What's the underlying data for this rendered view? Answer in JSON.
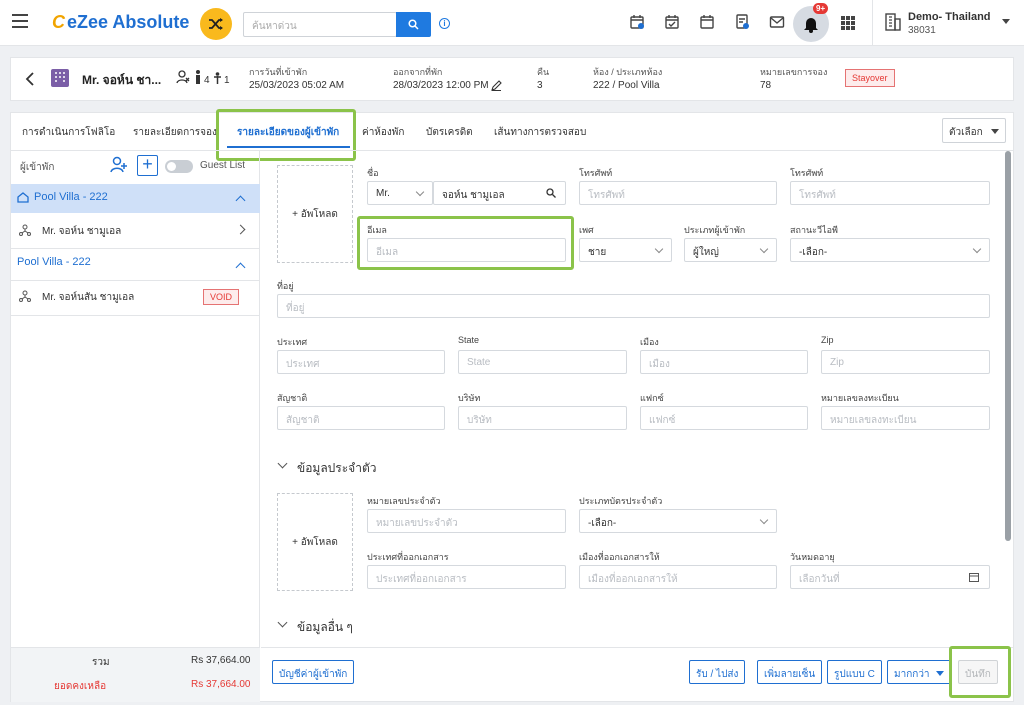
{
  "topbar": {
    "logo_prefix": "C",
    "logo_text": "eZee Absolute",
    "search_placeholder": "ค้นหาด่วน",
    "notif_badge": "9+",
    "property_name": "Demo- Thailand",
    "property_id": "38031"
  },
  "reservation": {
    "guest_name": "Mr. จอห์น ชา...",
    "adults": "4",
    "children": "1",
    "checkin_label": "การวันที่เข้าพัก",
    "checkin_value": "25/03/2023 05:02 AM",
    "checkout_label": "ออกจากที่พัก",
    "checkout_value": "28/03/2023 12:00 PM",
    "nights_label": "คืน",
    "nights_value": "3",
    "room_label": "ห้อง / ประเภทห้อง",
    "room_value": "222 / Pool Villa",
    "resno_label": "หมายเลขการจอง",
    "resno_value": "78",
    "status": "Stayover"
  },
  "tabs": [
    "การดำเนินการโฟลิโอ",
    "รายละเอียดการจอง",
    "รายละเอียดของผู้เข้าพัก",
    "ค่าห้องพัก",
    "บัตรเครดิต",
    "เส้นทางการตรวจสอบ"
  ],
  "options_label": "ตัวเลือก",
  "left": {
    "guests_label": "ผู้เข้าพัก",
    "guest_list_label": "Guest List",
    "room1": "Pool Villa - 222",
    "guest1": "Mr. จอห์น ชามูเอล",
    "room2": "Pool Villa - 222",
    "guest2": "Mr. จอห์นสัน ชามูเอล",
    "void": "VOID",
    "total_label": "รวม",
    "total_value": "Rs 37,664.00",
    "balance_label": "ยอดคงเหลือ",
    "balance_value": "Rs 37,664.00"
  },
  "form": {
    "upload": "+ อัพโหลด",
    "name_label": "ชื่อ",
    "salutation": "Mr.",
    "name_value": "จอห์น ชามูเอล",
    "phone1_label": "โทรศัพท์",
    "phone1_ph": "โทรศัพท์",
    "phone2_label": "โทรศัพท์",
    "phone2_ph": "โทรศัพท์",
    "email_label": "อีเมล",
    "email_ph": "อีเมล",
    "gender_label": "เพศ",
    "gender_value": "ชาย",
    "guest_type_label": "ประเภทผู้เข้าพัก",
    "guest_type_value": "ผู้ใหญ่",
    "vip_label": "สถานะวีไอพี",
    "vip_value": "-เลือก-",
    "address_label": "ที่อยู่",
    "address_ph": "ที่อยู่",
    "country_label": "ประเทศ",
    "country_ph": "ประเทศ",
    "state_label": "State",
    "state_ph": "State",
    "city_label": "เมือง",
    "city_ph": "เมือง",
    "zip_label": "Zip",
    "zip_ph": "Zip",
    "nationality_label": "สัญชาติ",
    "nationality_ph": "สัญชาติ",
    "company_label": "บริษัท",
    "company_ph": "บริษัท",
    "fax_label": "แฟกซ์",
    "fax_ph": "แฟกซ์",
    "regno_label": "หมายเลขลงทะเบียน",
    "regno_ph": "หมายเลขลงทะเบียน",
    "id_section": "ข้อมูลประจำตัว",
    "idno_label": "หมายเลขประจำตัว",
    "idno_ph": "หมายเลขประจำตัว",
    "idtype_label": "ประเภทบัตรประจำตัว",
    "idtype_value": "-เลือก-",
    "expiry_label": "วันหมดอายุ",
    "expiry_ph": "เลือกวันที่",
    "issue_country_label": "ประเทศที่ออกเอกสาร",
    "issue_country_ph": "ประเทศที่ออกเอกสาร",
    "issue_city_label": "เมืองที่ออกเอกสารให้",
    "issue_city_ph": "เมืองที่ออกเอกสารให้",
    "other_section": "ข้อมูลอื่น ๆ"
  },
  "buttons": {
    "guest_account": "บัญชีค่าผู้เข้าพัก",
    "pickup": "รับ / ไปส่ง",
    "signature": "เพิ่มลายเซ็น",
    "photo": "รูปแบบ C",
    "more": "มากกว่า",
    "save": "บันทึก"
  }
}
